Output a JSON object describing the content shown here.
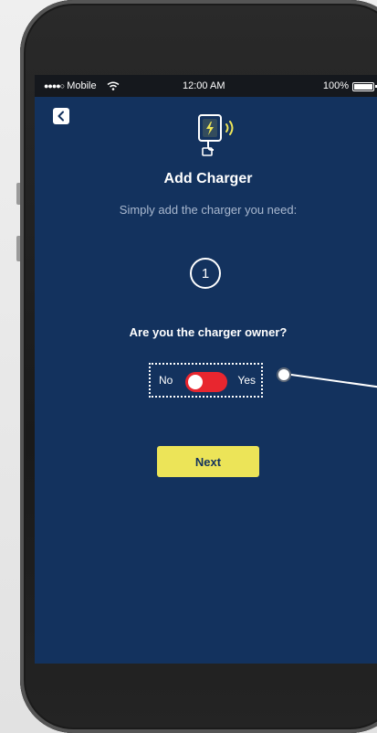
{
  "status_bar": {
    "carrier": "Mobile",
    "signal_dots": "●●●●○",
    "time": "12:00 AM",
    "battery": "100%"
  },
  "header": {
    "back_icon": "chevron-left-icon",
    "charger_icon": "phone-charger-nfc-icon",
    "title": "Add Charger",
    "subtitle": "Simply add the charger you need:"
  },
  "step": {
    "number": "1"
  },
  "owner_question": {
    "label": "Are you the charger owner?",
    "no_label": "No",
    "yes_label": "Yes",
    "toggle_state": "No"
  },
  "actions": {
    "next_label": "Next"
  },
  "colors": {
    "screen_bg": "#13325e",
    "accent_yellow": "#ece458",
    "toggle_red": "#e8262f"
  }
}
